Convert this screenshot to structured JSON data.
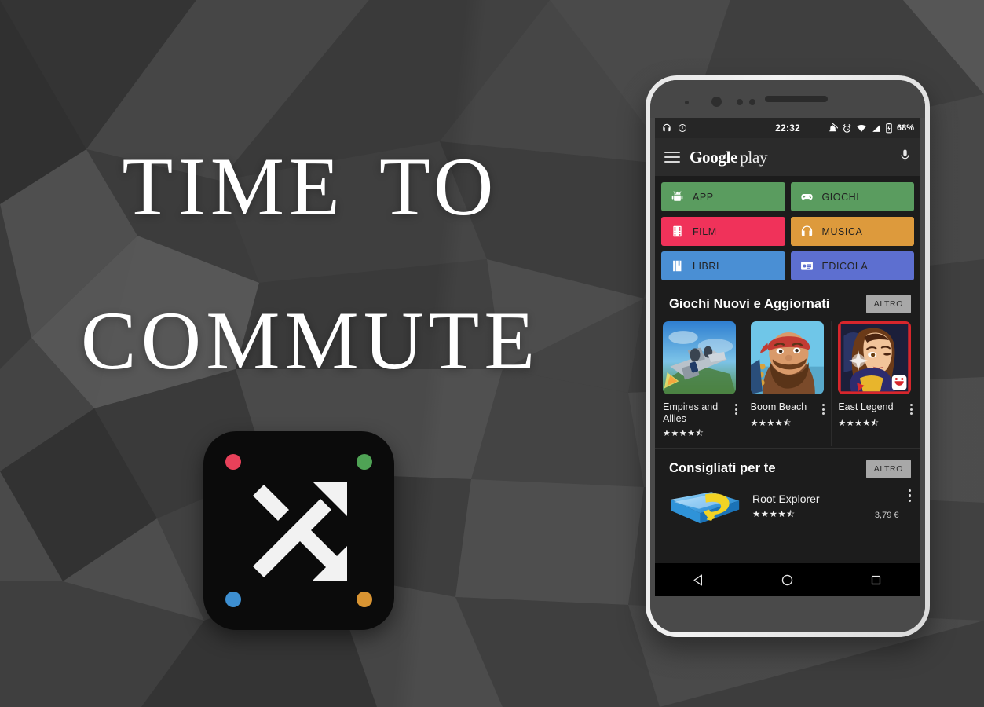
{
  "promo": {
    "line1": "Time to",
    "line2": "Commute",
    "text_color": "#ffffff"
  },
  "app_icon": {
    "name": "shuffle-app-icon",
    "background": "#0b0b0b",
    "glyph": "crossing-arrows",
    "dots": [
      {
        "position": "top-left",
        "color": "#e8415a"
      },
      {
        "position": "top-right",
        "color": "#4fa355"
      },
      {
        "position": "bottom-left",
        "color": "#3d8fd1"
      },
      {
        "position": "bottom-right",
        "color": "#d99432"
      }
    ]
  },
  "phone": {
    "statusbar": {
      "time": "22:32",
      "battery_percent": "68%",
      "left_icons": [
        "headphones-icon",
        "do-not-disturb-icon"
      ],
      "right_icons": [
        "bell-muted-icon",
        "alarm-icon",
        "wifi-icon",
        "signal-icon",
        "battery-charging-icon"
      ]
    },
    "header": {
      "brand_google": "Google",
      "brand_play": "play",
      "menu_icon": "hamburger-icon",
      "mic_icon": "microphone-icon"
    },
    "categories": [
      {
        "label": "APP",
        "color": "#5a9c5f",
        "icon": "android-icon"
      },
      {
        "label": "GIOCHI",
        "color": "#5a9c5f",
        "icon": "gamepad-icon"
      },
      {
        "label": "FILM",
        "color": "#f0325a",
        "icon": "film-strip-icon"
      },
      {
        "label": "MUSICA",
        "color": "#dd9a3c",
        "icon": "headphones-icon"
      },
      {
        "label": "LIBRI",
        "color": "#4a8fd4",
        "icon": "book-icon"
      },
      {
        "label": "EDICOLA",
        "color": "#5d6fd0",
        "icon": "newspaper-icon"
      }
    ],
    "sections": [
      {
        "title": "Giochi Nuovi e Aggiornati",
        "more_label": "ALTRO",
        "cards": [
          {
            "title": "Empires and Allies",
            "stars": "★★★★⯪",
            "thumb": "airplane-artwork"
          },
          {
            "title": "Boom Beach",
            "stars": "★★★★⯪",
            "thumb": "bearded-warrior-artwork"
          },
          {
            "title": "East Legend",
            "stars": "★★★★⯪",
            "thumb": "anime-heroine-artwork"
          }
        ]
      },
      {
        "title": "Consigliati per te",
        "more_label": "ALTRO",
        "items": [
          {
            "title": "Root Explorer",
            "stars": "★★★★⯪",
            "price": "3,79 €",
            "icon": "root-explorer-icon"
          }
        ]
      }
    ],
    "navbar": {
      "back_label": "back-button",
      "home_label": "home-button",
      "recents_label": "recents-button"
    }
  }
}
